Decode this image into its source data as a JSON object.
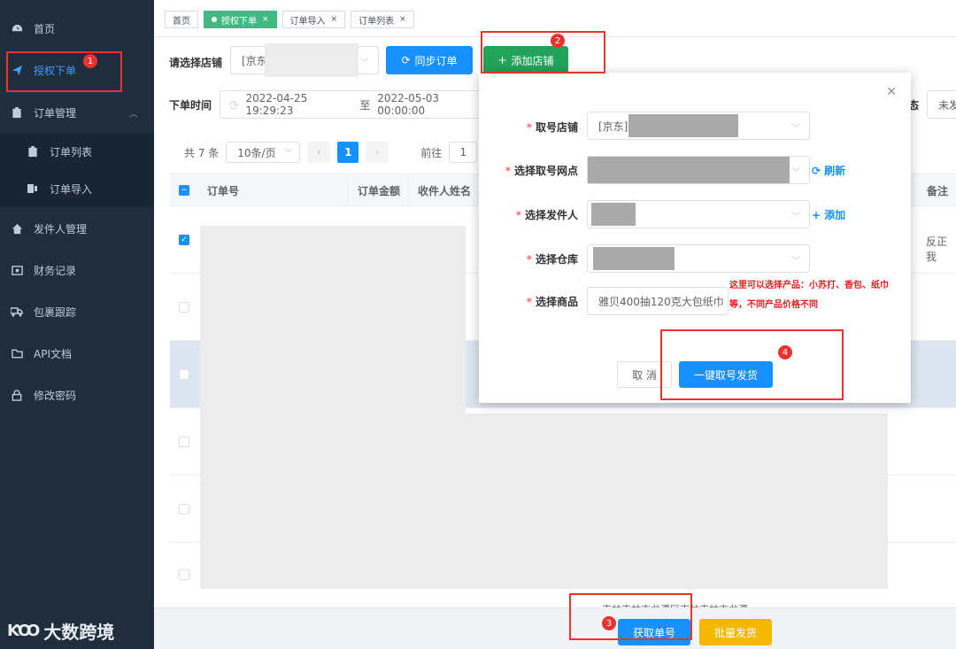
{
  "sidebar": {
    "items": [
      {
        "label": "首页",
        "icon": "dashboard-icon"
      },
      {
        "label": "授权下单",
        "icon": "send-icon"
      },
      {
        "label": "订单管理",
        "icon": "clipboard-icon"
      },
      {
        "label": "订单列表",
        "icon": "clipboard-icon"
      },
      {
        "label": "订单导入",
        "icon": "import-icon"
      },
      {
        "label": "发件人管理",
        "icon": "home-icon"
      },
      {
        "label": "财务记录",
        "icon": "finance-icon"
      },
      {
        "label": "包裹跟踪",
        "icon": "truck-icon"
      },
      {
        "label": "API文档",
        "icon": "folder-icon"
      },
      {
        "label": "修改密码",
        "icon": "lock-icon"
      }
    ],
    "logo_mark": "ƘꝎ",
    "logo_text": "大数跨境"
  },
  "tags": [
    {
      "label": "首页"
    },
    {
      "label": "授权下单"
    },
    {
      "label": "订单导入"
    },
    {
      "label": "订单列表"
    }
  ],
  "filters": {
    "store_label": "请选择店铺",
    "store_value": "[京东",
    "sync_button": "同步订单",
    "add_store_button": "添加店铺",
    "time_label": "下单时间",
    "time_start": "2022-04-25 19:29:23",
    "time_sep": "至",
    "time_end": "2022-05-03 00:00:00",
    "status_label": "态",
    "status_value": "未发"
  },
  "pager": {
    "total": "共 7 条",
    "page_size": "10条/页",
    "current": "1",
    "goto_label": "前往",
    "goto_value": "1"
  },
  "table": {
    "headers": [
      "订单号",
      "订单金额",
      "收件人姓名",
      "备注"
    ],
    "remark_value": "反正我",
    "address_text": "吉林吉林市龙潭区吉林吉林市龙潭"
  },
  "bottom": {
    "get_number_button": "获取单号",
    "batch_ship_button": "批量发货"
  },
  "dialog": {
    "fields": [
      {
        "label": "取号店铺",
        "value": "[京东]"
      },
      {
        "label": "选择取号网点",
        "value": ""
      },
      {
        "label": "选择发件人",
        "value": ""
      },
      {
        "label": "选择仓库",
        "value": ""
      },
      {
        "label": "选择商品",
        "value": "雅贝400抽120克大包纸巾"
      }
    ],
    "refresh_link": "刷新",
    "add_link": "添加",
    "note_text": "这里可以选择产品：小苏打、香包、纸巾等，不同产品价格不同",
    "cancel_button": "取 消",
    "confirm_button": "一键取号发货"
  },
  "annotations": [
    "1",
    "2",
    "3",
    "4"
  ],
  "colors": {
    "sidebar_bg": "#1f2d3d",
    "primary": "#1890ff",
    "success": "#21a35a",
    "warning": "#f5b800",
    "annotation": "#e8332f"
  }
}
